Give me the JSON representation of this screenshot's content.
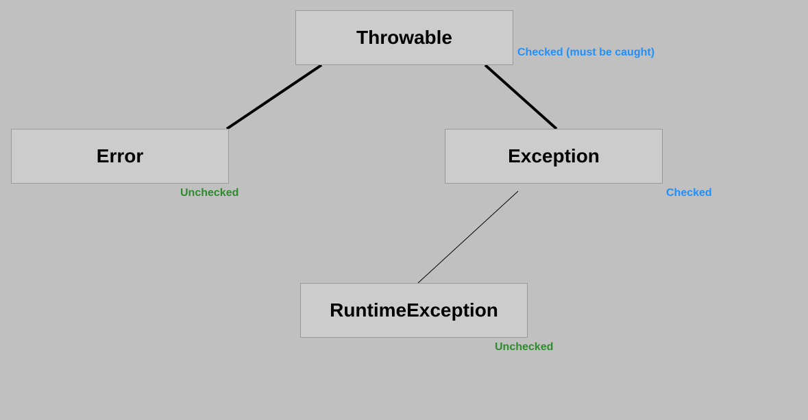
{
  "nodes": {
    "throwable": {
      "label": "Throwable",
      "annotation": "Checked (must be caught)"
    },
    "error": {
      "label": "Error",
      "annotation": "Unchecked"
    },
    "exception": {
      "label": "Exception",
      "annotation": "Checked"
    },
    "runtimeException": {
      "label": "RuntimeException",
      "annotation": "Unchecked"
    }
  }
}
